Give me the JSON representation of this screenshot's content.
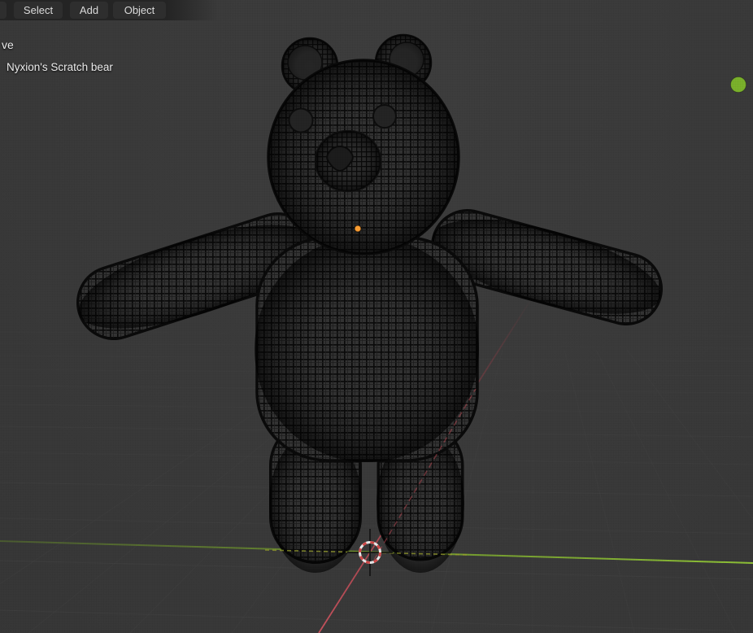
{
  "header": {
    "menus": [
      {
        "label": "Select"
      },
      {
        "label": "Add"
      },
      {
        "label": "Object"
      }
    ]
  },
  "viewport": {
    "hud": {
      "view_mode_fragment": "ve",
      "active_object_label": "Nyxion's Scratch bear"
    },
    "colors": {
      "viewport_bg": "#3b3b3b",
      "header_bg": "#242424",
      "menu_button_bg": "#2e2e2e",
      "menu_text": "#dadada",
      "hud_text": "#ebebeb",
      "grid_line": "#4a4a4a",
      "axis_y_green": "#8cc038",
      "axis_x_red": "#c04a55",
      "light_dot": "#7cb32c",
      "origin_dot": "#ffa033",
      "cursor_red": "#d24848",
      "cursor_white": "#ececec",
      "foot_contact_dash": "#9aa12e",
      "wire_dark": "#0b0b0b",
      "bear_surface": "#343434"
    }
  }
}
